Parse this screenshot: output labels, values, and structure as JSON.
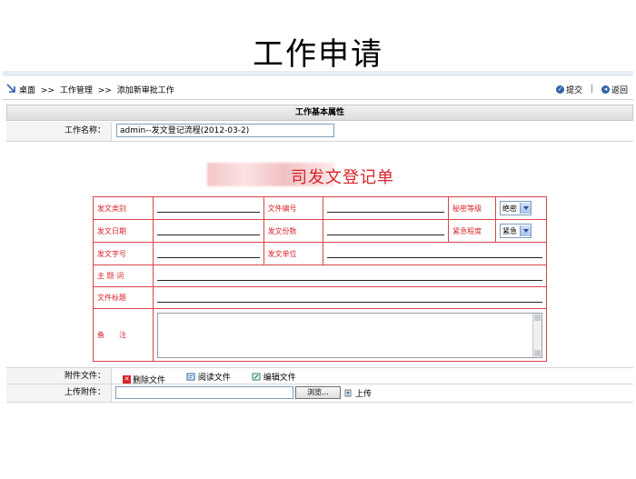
{
  "slide_title": "工作申请",
  "breadcrumb": [
    "桌面",
    ">>",
    "工作管理",
    ">>",
    "添加新审批工作"
  ],
  "toolbar": {
    "submit_label": "提交",
    "separator": "|",
    "back_label": "返回"
  },
  "section_header": "工作基本属性",
  "work_name": {
    "label": "工作名称：",
    "value": "admin--发文登记流程(2012-03-2)"
  },
  "form_title": "司发文登记单",
  "form": {
    "doc_type_label": "发文类别",
    "doc_number_label": "文件编号",
    "secret_level_label": "秘密等级",
    "secret_level_value": "绝密",
    "send_date_label": "发文日期",
    "copies_label": "发文份数",
    "urgency_label": "紧急程度",
    "urgency_value": "紧急",
    "doc_code_label": "发文字号",
    "issuer_label": "发文单位",
    "keywords_label": "主 题 词",
    "title_label": "文件标题",
    "remarks_label": "备　　注"
  },
  "attachment": {
    "label": "附件文件：",
    "delete_label": "删除文件",
    "read_label": "阅读文件",
    "edit_label": "编辑文件"
  },
  "upload": {
    "label": "上传附件：",
    "browse_label": "浏览...",
    "upload_label": "上传"
  },
  "colors": {
    "accent_red": "#d8242a",
    "border_red": "#d9444a",
    "blue": "#2f62a8"
  }
}
